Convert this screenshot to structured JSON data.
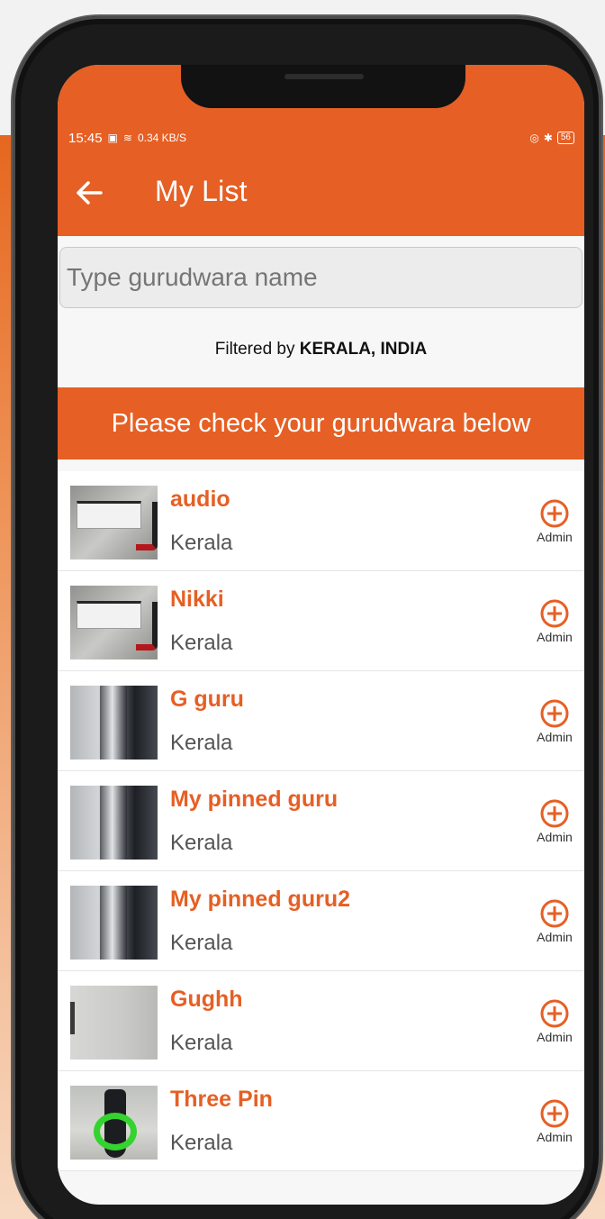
{
  "status_bar": {
    "time": "15:45",
    "network_speed": "0.34 KB/S",
    "battery": "56"
  },
  "app_bar": {
    "title": "My List"
  },
  "search": {
    "placeholder": "Type gurudwara name"
  },
  "filter": {
    "prefix": "Filtered by",
    "location": "KERALA, INDIA"
  },
  "banner": {
    "text": "Please check your gurudwara below"
  },
  "list": {
    "items": [
      {
        "name": "audio",
        "state": "Kerala",
        "action": "Admin",
        "thumbnail": "device-photo"
      },
      {
        "name": "Nikki",
        "state": "Kerala",
        "action": "Admin",
        "thumbnail": "device-photo"
      },
      {
        "name": "G guru",
        "state": "Kerala",
        "action": "Admin",
        "thumbnail": "bottle-photo"
      },
      {
        "name": "My pinned guru",
        "state": "Kerala",
        "action": "Admin",
        "thumbnail": "bottle-photo"
      },
      {
        "name": "My pinned guru2",
        "state": "Kerala",
        "action": "Admin",
        "thumbnail": "bottle-photo"
      },
      {
        "name": "Gughh",
        "state": "Kerala",
        "action": "Admin",
        "thumbnail": "wall-photo"
      },
      {
        "name": "Three Pin",
        "state": "Kerala",
        "action": "Admin",
        "thumbnail": "green-object-photo"
      }
    ]
  },
  "colors": {
    "primary": "#E65F24",
    "page_background": "#F7F7F7",
    "phone_frame": "#1B1B1B"
  },
  "icons": {
    "back": "arrow-left-icon",
    "admin_action": "plus-circle-icon"
  }
}
